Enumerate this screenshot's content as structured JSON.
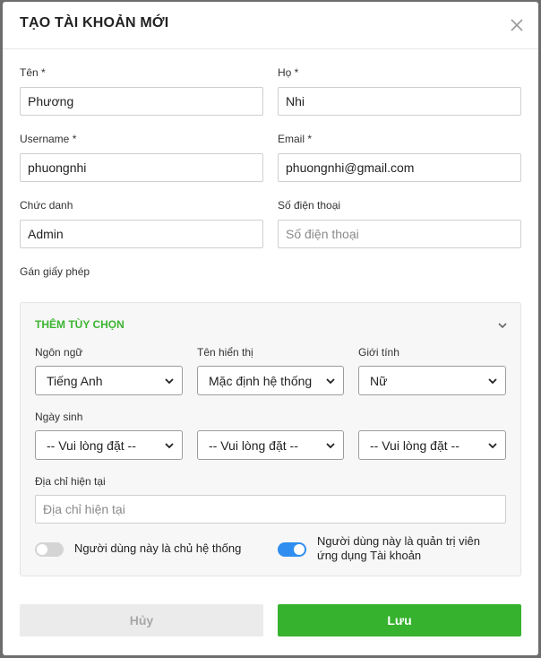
{
  "modal": {
    "title": "TẠO TÀI KHOẢN MỚI",
    "close_icon": "close-icon"
  },
  "form": {
    "first_name": {
      "label": "Tên *",
      "value": "Phương"
    },
    "last_name": {
      "label": "Họ *",
      "value": "Nhi"
    },
    "username": {
      "label": "Username *",
      "value": "phuongnhi"
    },
    "email": {
      "label": "Email *",
      "value": "phuongnhi@gmail.com"
    },
    "job_title": {
      "label": "Chức danh",
      "value": "Admin"
    },
    "phone": {
      "label": "Số điện thoại",
      "value": "",
      "placeholder": "Số điện thoại"
    },
    "license_label": "Gán giấy phép"
  },
  "options": {
    "title": "THÊM TÙY CHỌN",
    "language": {
      "label": "Ngôn ngữ",
      "value": "Tiếng Anh"
    },
    "display_name": {
      "label": "Tên hiển thị",
      "value": "Mặc định hệ thống"
    },
    "gender": {
      "label": "Giới tính",
      "value": "Nữ"
    },
    "birthday": {
      "label": "Ngày sinh",
      "day": "-- Vui lòng đặt --",
      "month": "-- Vui lòng đặt --",
      "year": "-- Vui lòng đặt --"
    },
    "address": {
      "label": "Địa chỉ hiện tại",
      "value": "",
      "placeholder": "Địa chỉ hiện tại"
    },
    "system_owner_toggle": {
      "label": "Người dùng này là chủ hệ thống",
      "on": false
    },
    "app_admin_toggle": {
      "label_line1": "Người dùng này là quản trị viên",
      "label_line2": "ứng dụng Tài khoản",
      "on": true
    }
  },
  "buttons": {
    "cancel": "Hủy",
    "save": "Lưu"
  },
  "colors": {
    "accent_green": "#37b22f",
    "toggle_on": "#2f8ef0",
    "toggle_off": "#d4d4d4"
  }
}
